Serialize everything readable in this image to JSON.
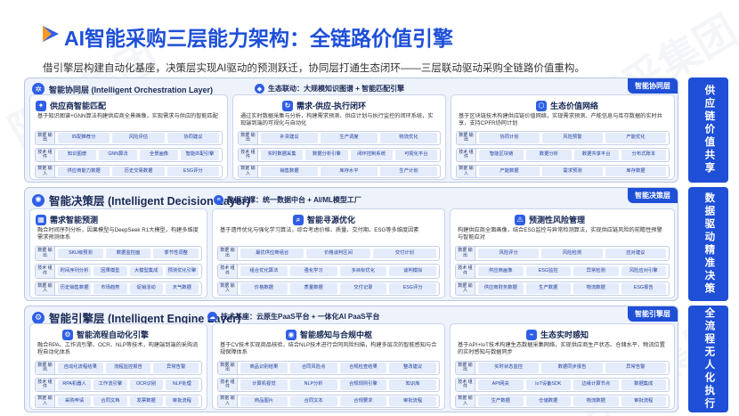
{
  "header": {
    "watermark": "阳采集团",
    "title": "AI智能采购三层能力架构：全链路价值引擎",
    "subtitle": "借引擎层构建自动化基座，决策层实现AI驱动的预测跃迁，协同层打通生态闭环——三层联动驱动采购全链路价值重构。"
  },
  "layers": {
    "collab": {
      "title": "智能协同层 (Intelligent Orchestration Layer)",
      "tag": "智能协同层",
      "strip": "生态联动：大规模知识图谱 + 智能匹配引擎",
      "cards": [
        {
          "title": "供应商智能匹配",
          "desc": "基于知识图谱+GNN算法构建供应商全景画像，实现需求与供应的智能匹配",
          "rows": [
            {
              "label": "数据 输出",
              "items": [
                "匹配推荐分",
                "风险评估",
                "协同建议"
              ]
            },
            {
              "label": "技术 组件",
              "items": [
                "知识图谱",
                "GNN算法",
                "全景画像",
                "智能匹配引擎"
              ]
            },
            {
              "label": "数据 输入",
              "items": [
                "供应商能力数据",
                "历史交易数据",
                "ESG评分"
              ]
            }
          ]
        },
        {
          "title": "需求-供应-执行闭环",
          "desc": "通过实时数据采集与分析，构建需求预测、供应计划与执行监控的闭环系统，实现端到端的可视化与自动化",
          "rows": [
            {
              "label": "数据 输出",
              "items": [
                "补货建议",
                "生产调度",
                "物流优化"
              ]
            },
            {
              "label": "技术 组件",
              "items": [
                "实时数据采集",
                "数据分析引擎",
                "闭环控制系统",
                "可视化平台"
              ]
            },
            {
              "label": "数据 输入",
              "items": [
                "销售数据",
                "库存水平",
                "生产计划"
              ]
            }
          ]
        },
        {
          "title": "生态价值网络",
          "desc": "基于区块链技术构建供应链价值网络，实现需求预测、产能信息与库存数据的实时共享，支持CPFR协同计划",
          "rows": [
            {
              "label": "数据 输出",
              "items": [
                "协同计划",
                "风险预警",
                "产能优化"
              ]
            },
            {
              "label": "技术 组件",
              "items": [
                "智能区块链",
                "数据分析",
                "数据共享平台",
                "分布式账本"
              ]
            },
            {
              "label": "数据 输入",
              "items": [
                "产能数据",
                "需求预测",
                "库存数据"
              ]
            }
          ]
        }
      ]
    },
    "decision": {
      "title": "智能决策层 (Intelligent Decision Layer)",
      "tag": "智能决策层",
      "strip": "数据支撑：统一数据中台 + AI/ML模型工厂",
      "cards": [
        {
          "title": "需求智能预测",
          "desc": "融合时间序列分析，因果模型与DeepSeek R1大模型，构建多维度需求预测体系",
          "rows": [
            {
              "label": "数据 输出",
              "items": [
                "SKU级预测",
                "数据监控面",
                "季节性调整"
              ]
            },
            {
              "label": "技术 组件",
              "items": [
                "时间序列分析",
                "因果模型",
                "大模型集成",
                "预测优化引擎"
              ]
            },
            {
              "label": "数据 输入",
              "items": [
                "历史销售数据",
                "市场趋势",
                "促销活动",
                "天气数据"
              ]
            }
          ]
        },
        {
          "title": "智能寻源优化",
          "desc": "基于遗传优化与强化学习算法，综合考虑价格、质量、交付期、ESG等多维度因素",
          "rows": [
            {
              "label": "数据 输出",
              "items": [
                "最优供应商组合",
                "价格谈判区间",
                "交付计划"
              ]
            },
            {
              "label": "技术 组件",
              "items": [
                "组合优化算法",
                "强化学习",
                "多目标优化",
                "谈判模拟"
              ]
            },
            {
              "label": "数据 输入",
              "items": [
                "价格数据",
                "质量数据",
                "交付记录",
                "ESG评分"
              ]
            }
          ]
        },
        {
          "title": "预测性风险管理",
          "desc": "构建供应商全面画像，结合ESG监控与异常检测算法，实现供应链风险的前瞻性预警与智能应对",
          "rows": [
            {
              "label": "数据 输出",
              "items": [
                "风险评分",
                "风险检测",
                "应对建议"
              ]
            },
            {
              "label": "技术 组件",
              "items": [
                "供应商画像",
                "ESG监控",
                "异常检测",
                "风险应对引擎"
              ]
            },
            {
              "label": "数据 输入",
              "items": [
                "供应商财务数据",
                "生产数据",
                "物流数据",
                "ESG报告"
              ]
            }
          ]
        }
      ]
    },
    "engine": {
      "title": "智能引擎层 (Intelligent Engine Layer)",
      "tag": "智能引擎层",
      "strip": "技术基座：云原生PaaS平台 + 一体化AI PaaS平台",
      "cards": [
        {
          "title": "智能流程自动化引擎",
          "desc": "融合RPA、工作流引擎、OCR、NLP等技术，构建端到端的采购流程自动化体系",
          "rows": [
            {
              "label": "数据 输出",
              "items": [
                "自动化流程结果",
                "流程监控报告",
                "异常告警"
              ]
            },
            {
              "label": "技术 组件",
              "items": [
                "RPA机器人",
                "工作流引擎",
                "OCR识别",
                "NLP处理"
              ]
            },
            {
              "label": "数据 输入",
              "items": [
                "采购申请",
                "合同文档",
                "发票数据",
                "审批流程"
              ]
            }
          ]
        },
        {
          "title": "智能感知与合规中枢",
          "desc": "基于CV技术实现商品核验，结合NLP技术进行合同风险扫描，构建多层次的智能感知与合规保障体系",
          "rows": [
            {
              "label": "数据 输出",
              "items": [
                "商品识别结果",
                "合同风险点",
                "合规检查结果",
                "整改建议"
              ]
            },
            {
              "label": "技术 组件",
              "items": [
                "计算机视觉",
                "NLP分析",
                "合规规则引擎",
                "知识库"
              ]
            },
            {
              "label": "数据 输入",
              "items": [
                "商品图片",
                "合同文本",
                "合规要求",
                "审批流程"
              ]
            }
          ]
        },
        {
          "title": "生态实时感知",
          "desc": "基于API+IoT技术构建生态数据采集网络，实现供应商生产状态、仓储水平、物流位置的实时感知与数据同步",
          "rows": [
            {
              "label": "数据 输出",
              "items": [
                "实时状态监控",
                "数据同步报告",
                "异常告警"
              ]
            },
            {
              "label": "技术 组件",
              "items": [
                "API网关",
                "IoT设备SDK",
                "边缘计算节点",
                "数据集成"
              ]
            },
            {
              "label": "数据 输入",
              "items": [
                "生产数据",
                "仓储数据",
                "物流数据",
                "审批流程"
              ]
            }
          ]
        }
      ]
    }
  },
  "side_labels": [
    "供应链价值共享",
    "数据驱动精准决策",
    "全流程无人化执行"
  ]
}
